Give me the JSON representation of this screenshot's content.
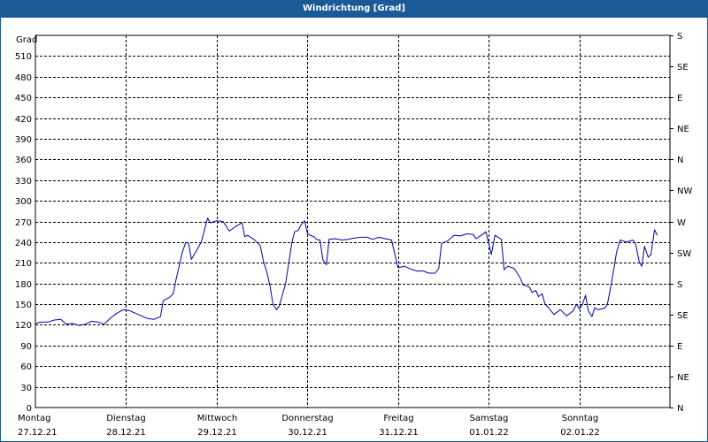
{
  "title": "Windrichtung [Grad]",
  "chart_data": {
    "type": "line",
    "title": "Windrichtung [Grad]",
    "ylabel": "Grad",
    "ylim": [
      0,
      540
    ],
    "yticks": [
      0,
      30,
      60,
      90,
      120,
      150,
      180,
      210,
      240,
      270,
      300,
      330,
      360,
      390,
      420,
      450,
      480,
      510
    ],
    "right_axis_labels": [
      {
        "label": "N",
        "value": 0
      },
      {
        "label": "NE",
        "value": 45
      },
      {
        "label": "E",
        "value": 90
      },
      {
        "label": "SE",
        "value": 135
      },
      {
        "label": "S",
        "value": 180
      },
      {
        "label": "SW",
        "value": 225
      },
      {
        "label": "W",
        "value": 270
      },
      {
        "label": "NW",
        "value": 315
      },
      {
        "label": "N",
        "value": 360
      },
      {
        "label": "NE",
        "value": 405
      },
      {
        "label": "E",
        "value": 450
      },
      {
        "label": "SE",
        "value": 495
      },
      {
        "label": "S",
        "value": 540
      }
    ],
    "xlim": [
      0,
      7
    ],
    "x_categories": [
      {
        "day": "Montag",
        "date": "27.12.21"
      },
      {
        "day": "Dienstag",
        "date": "28.12.21"
      },
      {
        "day": "Mittwoch",
        "date": "29.12.21"
      },
      {
        "day": "Donnerstag",
        "date": "30.12.21"
      },
      {
        "day": "Freitag",
        "date": "31.12.21"
      },
      {
        "day": "Samstag",
        "date": "01.01.22"
      },
      {
        "day": "Sonntag",
        "date": "02.01.22"
      }
    ],
    "grid": true,
    "series": [
      {
        "color": "#0000aa",
        "points": [
          [
            0.0,
            122
          ],
          [
            0.07,
            124
          ],
          [
            0.14,
            124
          ],
          [
            0.21,
            127
          ],
          [
            0.28,
            128
          ],
          [
            0.34,
            121
          ],
          [
            0.41,
            122
          ],
          [
            0.48,
            119
          ],
          [
            0.55,
            121
          ],
          [
            0.62,
            125
          ],
          [
            0.69,
            124
          ],
          [
            0.76,
            121
          ],
          [
            0.83,
            130
          ],
          [
            0.9,
            137
          ],
          [
            0.97,
            142
          ],
          [
            1.03,
            141
          ],
          [
            1.1,
            137
          ],
          [
            1.17,
            133
          ],
          [
            1.24,
            129
          ],
          [
            1.31,
            128
          ],
          [
            1.38,
            132
          ],
          [
            1.41,
            155
          ],
          [
            1.48,
            160
          ],
          [
            1.52,
            165
          ],
          [
            1.55,
            185
          ],
          [
            1.62,
            225
          ],
          [
            1.66,
            240
          ],
          [
            1.69,
            238
          ],
          [
            1.72,
            215
          ],
          [
            1.76,
            224
          ],
          [
            1.83,
            240
          ],
          [
            1.9,
            275
          ],
          [
            1.93,
            268
          ],
          [
            2.0,
            271
          ],
          [
            2.07,
            270
          ],
          [
            2.14,
            256
          ],
          [
            2.21,
            263
          ],
          [
            2.28,
            268
          ],
          [
            2.31,
            248
          ],
          [
            2.34,
            250
          ],
          [
            2.41,
            244
          ],
          [
            2.48,
            235
          ],
          [
            2.52,
            210
          ],
          [
            2.55,
            198
          ],
          [
            2.59,
            175
          ],
          [
            2.62,
            150
          ],
          [
            2.66,
            142
          ],
          [
            2.69,
            147
          ],
          [
            2.76,
            180
          ],
          [
            2.83,
            240
          ],
          [
            2.86,
            255
          ],
          [
            2.9,
            257
          ],
          [
            2.93,
            265
          ],
          [
            2.97,
            271
          ],
          [
            3.0,
            253
          ],
          [
            3.03,
            250
          ],
          [
            3.07,
            248
          ],
          [
            3.1,
            244
          ],
          [
            3.14,
            243
          ],
          [
            3.17,
            215
          ],
          [
            3.21,
            207
          ],
          [
            3.24,
            244
          ],
          [
            3.31,
            245
          ],
          [
            3.38,
            243
          ],
          [
            3.45,
            244
          ],
          [
            3.52,
            246
          ],
          [
            3.59,
            247
          ],
          [
            3.66,
            247
          ],
          [
            3.72,
            244
          ],
          [
            3.79,
            247
          ],
          [
            3.86,
            245
          ],
          [
            3.93,
            243
          ],
          [
            3.97,
            220
          ],
          [
            4.0,
            203
          ],
          [
            4.07,
            205
          ],
          [
            4.14,
            201
          ],
          [
            4.21,
            198
          ],
          [
            4.28,
            198
          ],
          [
            4.34,
            195
          ],
          [
            4.41,
            195
          ],
          [
            4.45,
            202
          ],
          [
            4.48,
            238
          ],
          [
            4.55,
            242
          ],
          [
            4.62,
            250
          ],
          [
            4.69,
            249
          ],
          [
            4.76,
            252
          ],
          [
            4.83,
            251
          ],
          [
            4.86,
            245
          ],
          [
            4.93,
            251
          ],
          [
            4.97,
            255
          ],
          [
            5.03,
            222
          ],
          [
            5.07,
            250
          ],
          [
            5.14,
            244
          ],
          [
            5.17,
            200
          ],
          [
            5.21,
            205
          ],
          [
            5.28,
            202
          ],
          [
            5.34,
            190
          ],
          [
            5.38,
            178
          ],
          [
            5.45,
            175
          ],
          [
            5.48,
            167
          ],
          [
            5.52,
            170
          ],
          [
            5.55,
            161
          ],
          [
            5.59,
            165
          ],
          [
            5.62,
            151
          ],
          [
            5.66,
            145
          ],
          [
            5.72,
            135
          ],
          [
            5.79,
            142
          ],
          [
            5.86,
            133
          ],
          [
            5.93,
            140
          ],
          [
            5.97,
            150
          ],
          [
            6.0,
            143
          ],
          [
            6.03,
            148
          ],
          [
            6.07,
            163
          ],
          [
            6.1,
            140
          ],
          [
            6.14,
            132
          ],
          [
            6.17,
            145
          ],
          [
            6.21,
            142
          ],
          [
            6.28,
            144
          ],
          [
            6.31,
            150
          ],
          [
            6.34,
            170
          ],
          [
            6.38,
            200
          ],
          [
            6.41,
            225
          ],
          [
            6.45,
            243
          ],
          [
            6.52,
            240
          ],
          [
            6.59,
            243
          ],
          [
            6.62,
            238
          ],
          [
            6.66,
            212
          ],
          [
            6.69,
            205
          ],
          [
            6.72,
            234
          ],
          [
            6.76,
            218
          ],
          [
            6.79,
            222
          ],
          [
            6.83,
            258
          ],
          [
            6.86,
            250
          ]
        ]
      }
    ]
  }
}
